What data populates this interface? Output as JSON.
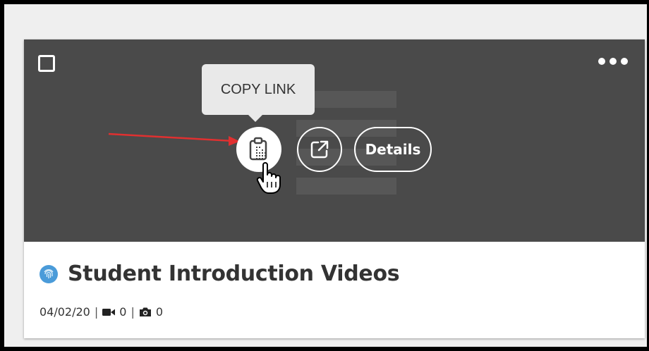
{
  "card": {
    "tooltip": "COPY LINK",
    "details_label": "Details",
    "title": "Student Introduction Videos",
    "date": "04/02/20",
    "separator": "|",
    "video_count": "0",
    "photo_count": "0"
  },
  "icons": {
    "checkbox": "checkbox-icon",
    "more": "more-options-icon",
    "copy": "clipboard-copy-icon",
    "external": "external-link-icon",
    "folder": "fingerprint-icon",
    "video": "video-camera-icon",
    "photo": "camera-icon",
    "cursor": "hand-pointer-cursor",
    "arrow": "red-arrow-annotation"
  },
  "colors": {
    "thumbnail_bg": "#4a4a4a",
    "folder_icon": "#4a9bd9",
    "arrow": "#e03030"
  }
}
